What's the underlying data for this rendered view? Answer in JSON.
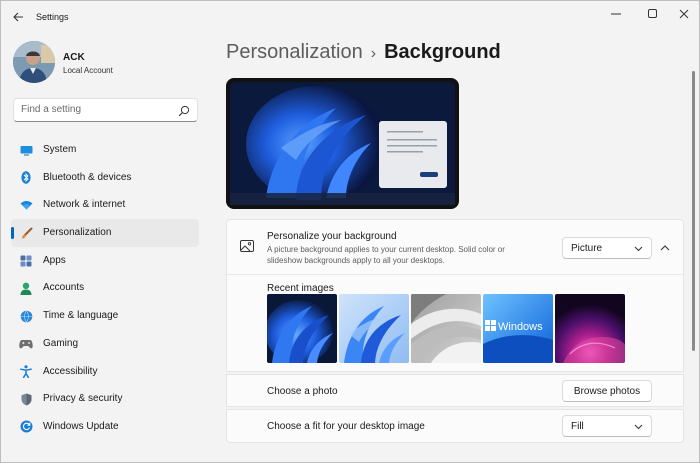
{
  "window": {
    "title": "Settings"
  },
  "profile": {
    "name": "ACK",
    "account_type": "Local Account"
  },
  "search": {
    "placeholder": "Find a setting"
  },
  "sidebar": {
    "items": [
      {
        "label": "System",
        "icon": "monitor-icon",
        "active": false
      },
      {
        "label": "Bluetooth & devices",
        "icon": "bluetooth-icon",
        "active": false
      },
      {
        "label": "Network & internet",
        "icon": "wifi-icon",
        "active": false
      },
      {
        "label": "Personalization",
        "icon": "paintbrush-icon",
        "active": true
      },
      {
        "label": "Apps",
        "icon": "apps-icon",
        "active": false
      },
      {
        "label": "Accounts",
        "icon": "person-icon",
        "active": false
      },
      {
        "label": "Time & language",
        "icon": "globe-clock-icon",
        "active": false
      },
      {
        "label": "Gaming",
        "icon": "gamepad-icon",
        "active": false
      },
      {
        "label": "Accessibility",
        "icon": "accessibility-icon",
        "active": false
      },
      {
        "label": "Privacy & security",
        "icon": "shield-icon",
        "active": false
      },
      {
        "label": "Windows Update",
        "icon": "update-icon",
        "active": false
      }
    ]
  },
  "breadcrumb": {
    "parent": "Personalization",
    "separator": "›",
    "current": "Background"
  },
  "personalize": {
    "title": "Personalize your background",
    "description": "A picture background applies to your current desktop. Solid color or slideshow backgrounds apply to all your desktops.",
    "selected": "Picture"
  },
  "recent_images": {
    "label": "Recent images",
    "images": [
      "bloom-dark-blue",
      "bloom-light-blue",
      "gray-ribbons",
      "windows-logo-text",
      "purple-glow"
    ],
    "windows_text": "Windows"
  },
  "choose_photo": {
    "label": "Choose a photo",
    "button": "Browse photos"
  },
  "choose_fit": {
    "label": "Choose a fit for your desktop image",
    "selected": "Fill"
  },
  "colors": {
    "accent": "#0067c0",
    "background": "#f3f3f3",
    "card": "#fbfbfb"
  }
}
